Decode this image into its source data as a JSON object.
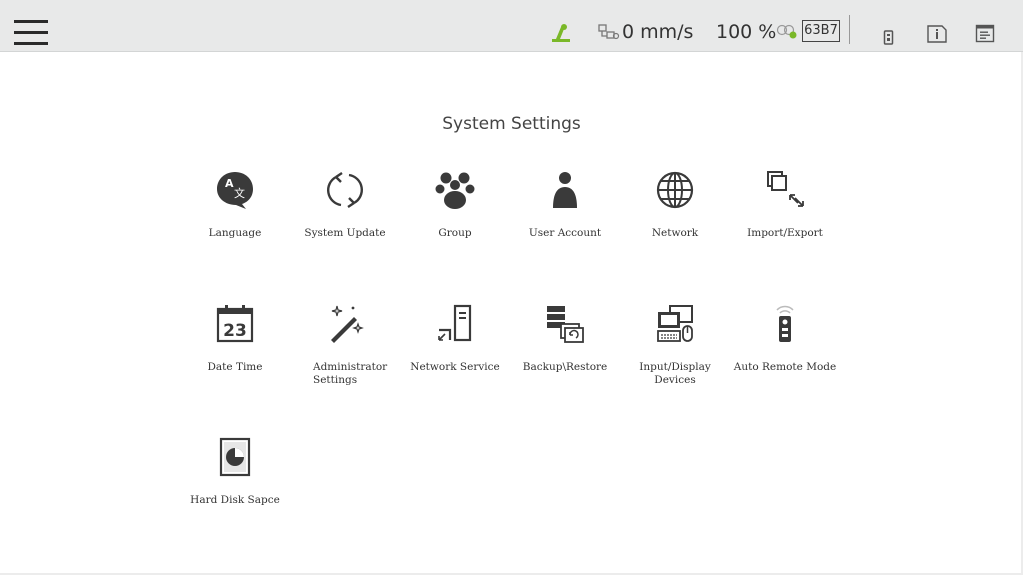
{
  "header": {
    "menu_icon": "hamburger-menu-icon",
    "robot_status_icon": "robot-arm-status-icon",
    "robot_status_color": "#7ab828",
    "speed_icon": "speed-icon",
    "speed": "0 mm/s",
    "override": "100 %",
    "tool_icon": "tool-connection-icon",
    "tool_status_color": "#7ab828",
    "tool_id": "63B7",
    "remote_icon": "remote-pendant-icon",
    "info_icon": "info-icon",
    "log_icon": "log-icon"
  },
  "main": {
    "title": "System Settings",
    "tiles": [
      {
        "label": "Language",
        "icon": "language-icon"
      },
      {
        "label": "System Update",
        "icon": "system-update-icon"
      },
      {
        "label": "Group",
        "icon": "group-icon"
      },
      {
        "label": "User Account",
        "icon": "user-account-icon"
      },
      {
        "label": "Network",
        "icon": "network-globe-icon"
      },
      {
        "label": "Import/Export",
        "icon": "import-export-icon"
      },
      {
        "label": "Date Time",
        "icon": "calendar-icon",
        "day": "23"
      },
      {
        "label": "Administrator\nSettings",
        "icon": "magic-wand-icon"
      },
      {
        "label": "Network Service",
        "icon": "network-service-icon"
      },
      {
        "label": "Backup\\Restore",
        "icon": "backup-restore-icon"
      },
      {
        "label": "Input/Display Devices",
        "icon": "input-display-devices-icon"
      },
      {
        "label": "Auto Remote Mode",
        "icon": "auto-remote-mode-icon"
      },
      {
        "label": "Hard Disk Sapce",
        "icon": "hard-disk-icon"
      }
    ]
  }
}
